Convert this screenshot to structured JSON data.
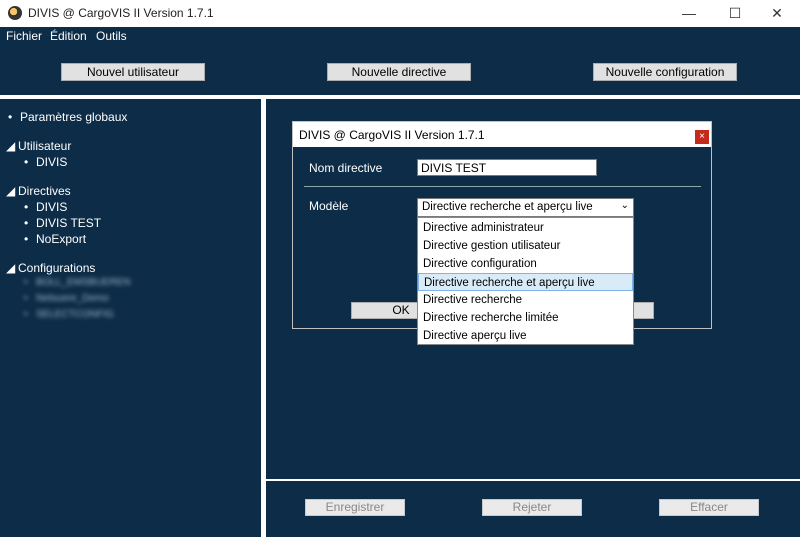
{
  "window": {
    "title": "DIVIS @ CargoVIS II Version 1.7.1",
    "minimize": "—",
    "maximize": "☐",
    "close": "✕"
  },
  "menu": [
    "Fichier",
    "Édition",
    "Outils"
  ],
  "toolbar": {
    "new_user": "Nouvel utilisateur",
    "new_directive": "Nouvelle directive",
    "new_config": "Nouvelle configuration"
  },
  "tree": {
    "global": "Paramètres globaux",
    "users_header": "Utilisateur",
    "users": [
      "DIVIS"
    ],
    "directives_header": "Directives",
    "directives": [
      "DIVIS",
      "DIVIS TEST",
      "NoExport"
    ],
    "configs_header": "Configurations",
    "configs": [
      "BOLL_EMSBUEREN",
      "Netsuere_Demo",
      "SELECTCONFIG"
    ]
  },
  "dialog": {
    "title": "DIVIS @ CargoVIS II Version 1.7.1",
    "close": "×",
    "name_label": "Nom directive",
    "name_value": "DIVIS TEST",
    "model_label": "Modèle",
    "model_selected": "Directive recherche et aperçu live",
    "ok": "OK",
    "options": [
      "Directive administrateur",
      "Directive gestion utilisateur",
      "Directive configuration",
      "Directive recherche et aperçu live",
      "Directive recherche",
      "Directive recherche limitée",
      "Directive aperçu live"
    ]
  },
  "bottom": {
    "save": "Enregistrer",
    "reject": "Rejeter",
    "clear": "Effacer"
  }
}
